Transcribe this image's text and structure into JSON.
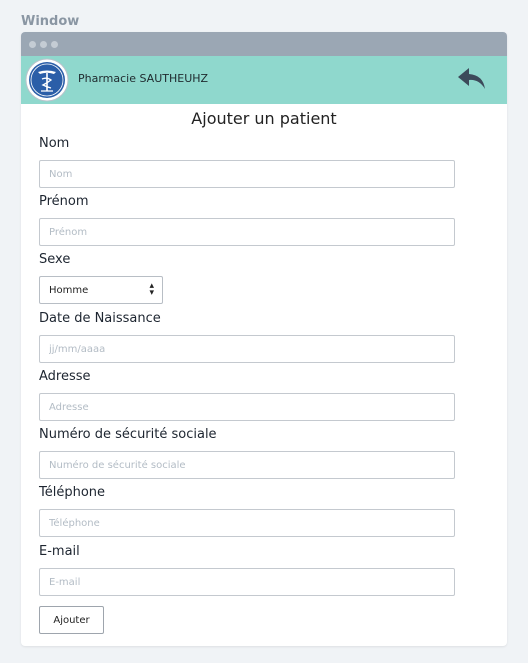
{
  "outer_label": "Window",
  "header": {
    "pharmacy_name": "Pharmacie SAUTHEUHZ"
  },
  "form": {
    "title": "Ajouter un patient",
    "nom_label": "Nom",
    "nom_placeholder": "Nom",
    "prenom_label": "Prénom",
    "prenom_placeholder": "Prénom",
    "sexe_label": "Sexe",
    "sexe_value": "Homme",
    "dob_label": "Date de Naissance",
    "dob_placeholder": "jj/mm/aaaa",
    "adresse_label": "Adresse",
    "adresse_placeholder": "Adresse",
    "secu_label": "Numéro de sécurité sociale",
    "secu_placeholder": "Numéro de sécurité sociale",
    "tel_label": "Téléphone",
    "tel_placeholder": "Téléphone",
    "email_label": "E-mail",
    "email_placeholder": "E-mail",
    "submit_label": "Ajouter"
  },
  "colors": {
    "header_bg": "#8fd8cd",
    "titlebar_bg": "#9ba7b4",
    "logo_blue": "#2b5ea8"
  },
  "icons": {
    "logo": "pharmacy-caduceus-icon",
    "back": "reply-arrow-icon",
    "select_arrow": "up-down-caret-icon"
  }
}
